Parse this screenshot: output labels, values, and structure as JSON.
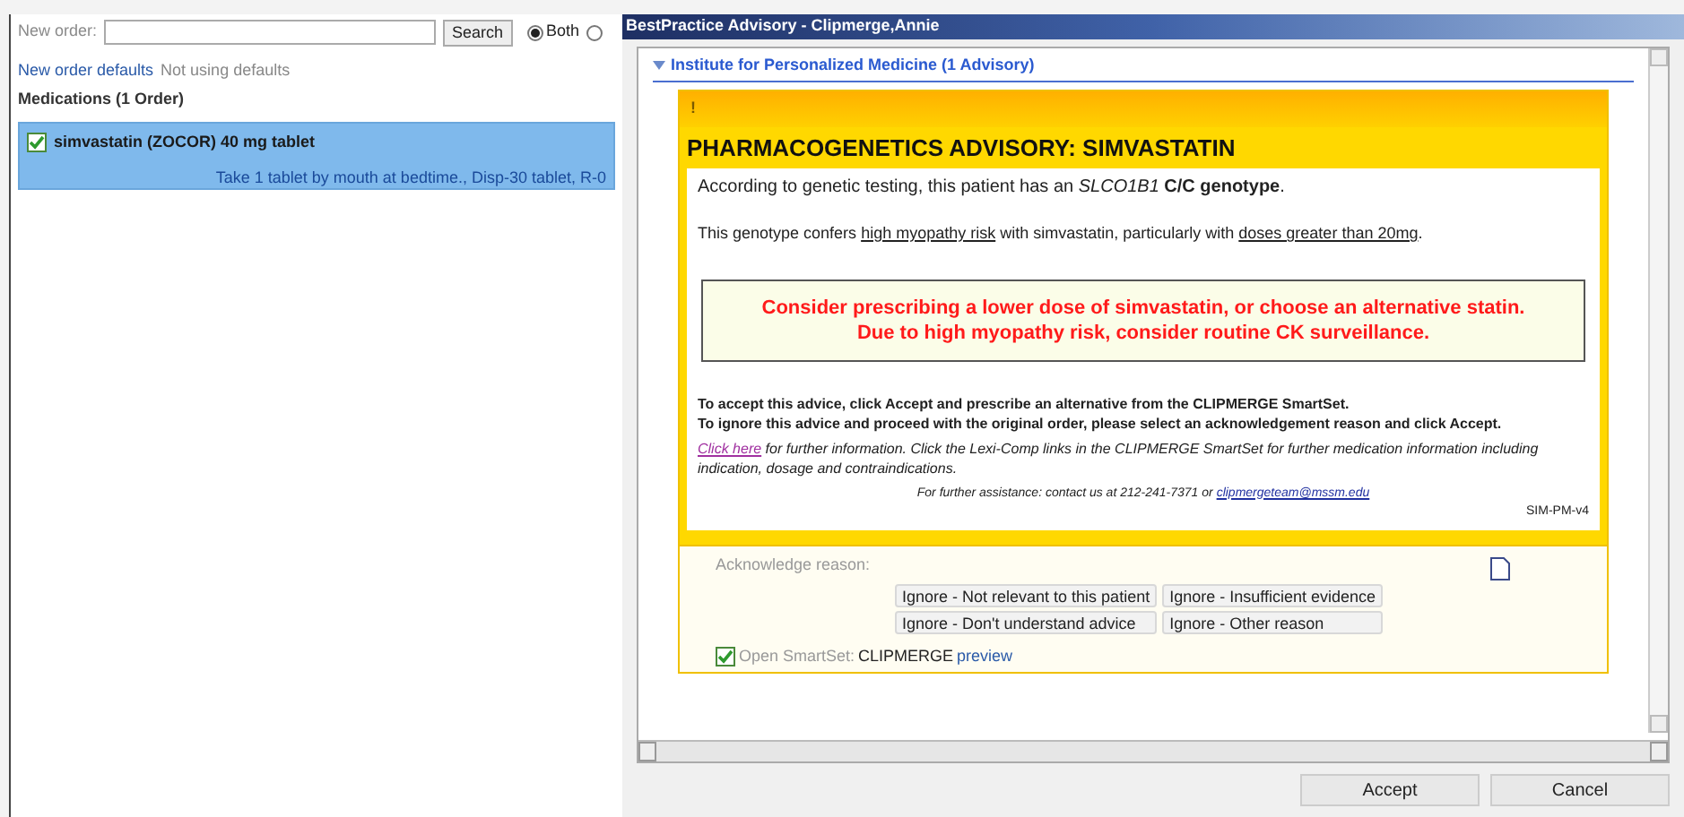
{
  "order_panel": {
    "new_order_label": "New order:",
    "search_button": "Search",
    "radios": [
      {
        "label": "Both",
        "selected": true
      },
      {
        "selected": false
      }
    ],
    "defaults_link": "New order defaults",
    "defaults_status": "Not using defaults",
    "section_title": "Medications (1 Order)",
    "orders": [
      {
        "name": "simvastatin (ZOCOR) 40 mg tablet",
        "sig": "Take 1 tablet by mouth at bedtime., Disp-30 tablet, R-0",
        "checked": true,
        "selected": true
      }
    ]
  },
  "dialog": {
    "title": "BestPractice Advisory  - Clipmerge,Annie",
    "group": {
      "title": "Institute for Personalized Medicine (1 Advisory)",
      "expanded": true
    },
    "advisory": {
      "alert_mark": "!",
      "title": "PHARMACOGENETICS ADVISORY: SIMVASTATIN",
      "genotype_line": "According to genetic testing, this patient has an *SLCO1B1* **C/C genotype**.",
      "risk_line": [
        {
          "text": "This genotype confers ",
          "underlined": false
        },
        {
          "text": "high myopathy risk",
          "underlined": true
        },
        {
          "text": " with simvastatin, particularly with ",
          "underlined": false
        },
        {
          "text": "doses greater than 20mg",
          "underlined": true
        },
        {
          "text": ".",
          "underlined": false
        }
      ],
      "recommendation": [
        "Consider prescribing a lower dose of simvastatin, or choose an alternative statin.",
        "Due to high myopathy risk, consider routine CK surveillance."
      ],
      "instructions": [
        "To accept this advice, click Accept and prescribe an alternative from the CLIPMERGE SmartSet.",
        "To ignore this advice and proceed with the original order, please select an acknowledgement reason and click Accept."
      ],
      "info_link": "Click here",
      "info_text": " for further information. Click the Lexi-Comp links in the CLIPMERGE SmartSet for further medication information including indication, dosage and contraindications.",
      "assist_text": "For further assistance: contact us at 212-241-7371 or ",
      "assist_email": "clipmergeteam@mssm.edu",
      "code": "SIM-PM-v4"
    },
    "acknowledge": {
      "label": "Acknowledge reason:",
      "reasons": [
        {
          "label": "Ignore - Not relevant to this patient",
          "selected": false
        },
        {
          "label": "Ignore - Insufficient evidence",
          "selected": false
        },
        {
          "label": "Ignore - Don't understand advice",
          "selected": false
        },
        {
          "label": "Ignore - Other reason",
          "selected": false
        }
      ],
      "smartset": {
        "label": "Open SmartSet:",
        "name": "CLIPMERGE",
        "link": "preview",
        "checked": true
      }
    },
    "buttons": [
      {
        "label": "Accept"
      },
      {
        "label": "Cancel"
      }
    ]
  }
}
